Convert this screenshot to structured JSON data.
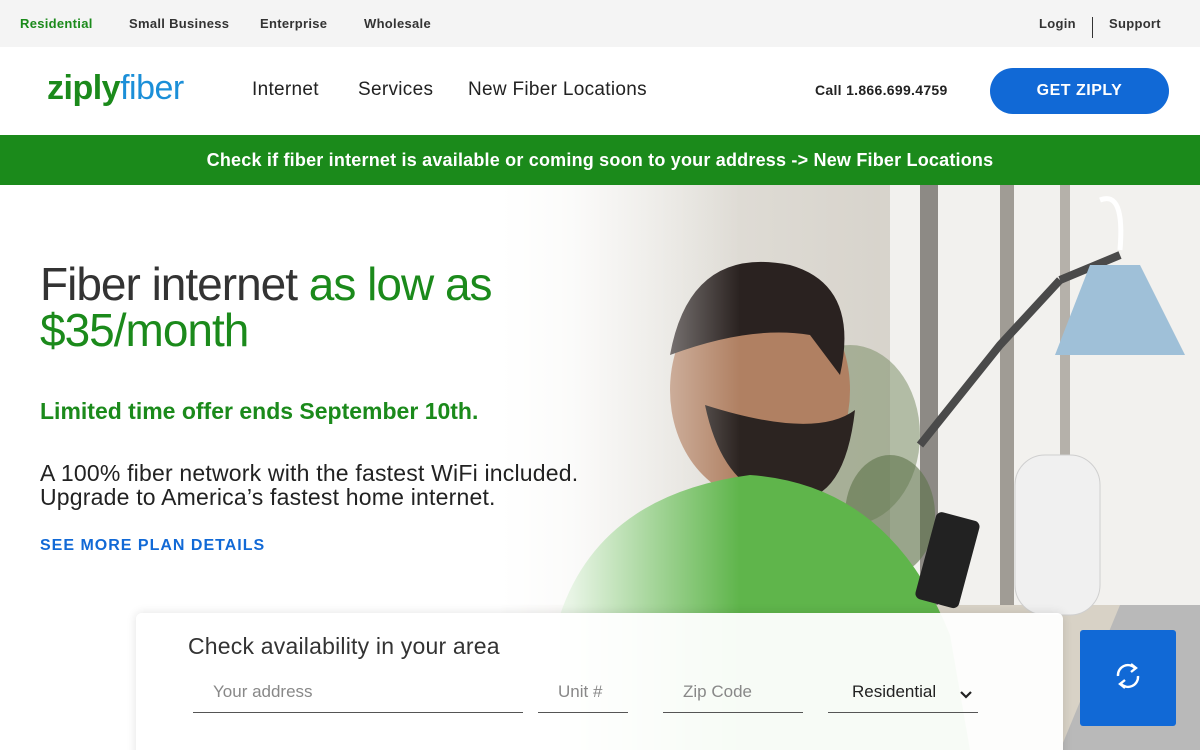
{
  "utility": {
    "segments": [
      "Residential",
      "Small Business",
      "Enterprise",
      "Wholesale"
    ],
    "login": "Login",
    "support": "Support"
  },
  "header": {
    "logo_ziply": "ziply",
    "logo_fiber": "fiber",
    "nav": [
      "Internet",
      "Services",
      "New Fiber Locations"
    ],
    "phone": "Call 1.866.699.4759",
    "cta": "GET ZIPLY"
  },
  "promo": {
    "text": "Check if fiber internet is available or coming soon to your address -> New Fiber Locations"
  },
  "hero": {
    "headline_dark": "Fiber internet",
    "headline_green_1": "as low as",
    "headline_green_2": "$35/month",
    "offer": "Limited time offer ends September 10th.",
    "subcopy_1": "A 100% fiber network with the fastest WiFi included.",
    "subcopy_2": "Upgrade to America’s fastest home internet.",
    "more_link": "SEE MORE PLAN DETAILS"
  },
  "availability": {
    "title": "Check availability in your area",
    "address_placeholder": "Your address",
    "unit_placeholder": "Unit #",
    "zip_placeholder": "Zip Code",
    "type_selected": "Residential"
  },
  "colors": {
    "brand_green": "#1b8a1b",
    "brand_blue": "#1169d6",
    "logo_blue": "#1b8fd8"
  },
  "icons": {
    "select": "chevron-down-icon",
    "go": "refresh-icon"
  }
}
